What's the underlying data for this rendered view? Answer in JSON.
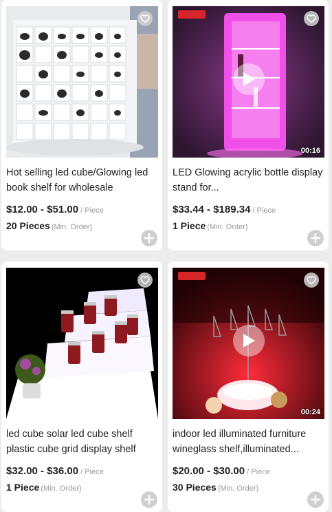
{
  "products": [
    {
      "title": "Hot selling led cube/Glowing led book shelf for wholesale",
      "price": "$12.00 - $51.00",
      "unit": "/ Piece",
      "moq": "20 Pieces",
      "moq_note": "(Min. Order)",
      "has_video": false,
      "duration": ""
    },
    {
      "title": "LED Glowing acrylic bottle display stand for...",
      "price": "$33.44 - $189.34",
      "unit": "/ Piece",
      "moq": "1 Piece",
      "moq_note": "(Min. Order)",
      "has_video": true,
      "duration": "00:16"
    },
    {
      "title": "led cube solar led cube shelf plastic cube grid display shelf",
      "price": "$32.00 - $36.00",
      "unit": "/ Piece",
      "moq": "1 Piece",
      "moq_note": "(Min. Order)",
      "has_video": false,
      "duration": ""
    },
    {
      "title": "indoor led illuminated furniture wineglass shelf,illuminated...",
      "price": "$20.00 - $30.00",
      "unit": "/ Piece",
      "moq": "30 Pieces",
      "moq_note": "(Min. Order)",
      "has_video": true,
      "duration": "00:24"
    }
  ],
  "icons": {
    "favorite": "heart-icon",
    "add": "plus-icon",
    "play": "play-icon"
  },
  "colors": {
    "page_background": "#ececec",
    "card_background": "#ffffff",
    "text": "#222222",
    "muted_text": "#999999",
    "add_button": "#cfcfcf"
  }
}
